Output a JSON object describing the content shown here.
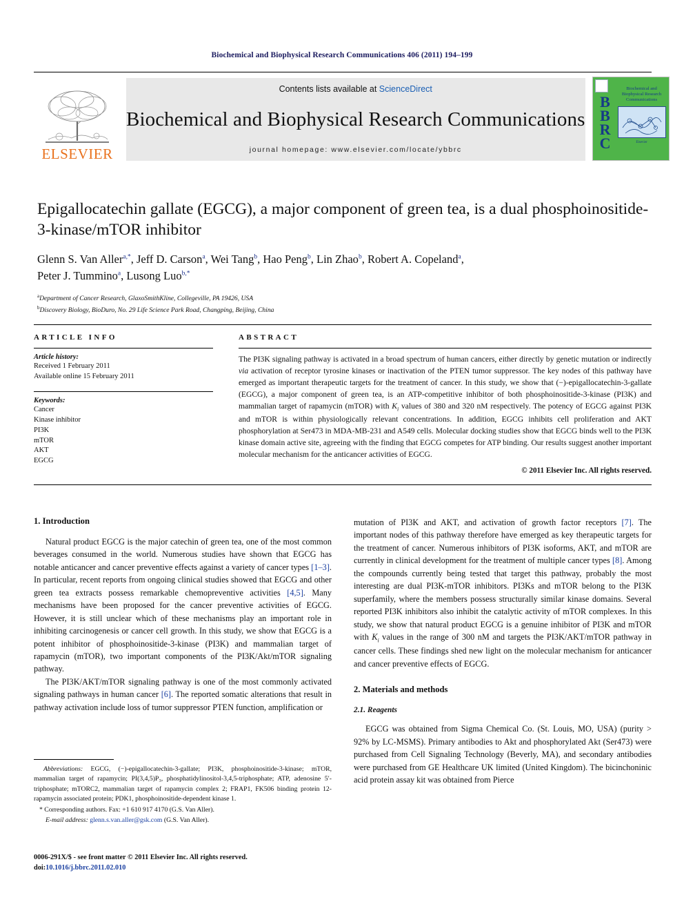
{
  "running_head": "Biochemical and Biophysical Research Communications 406 (2011) 194–199",
  "masthead": {
    "contents_prefix": "Contents lists available at ",
    "sciencedirect": "ScienceDirect",
    "journal_title": "Biochemical and Biophysical Research Communications",
    "homepage": "journal homepage: www.elsevier.com/locate/ybbrc",
    "elsevier_wordmark": "ELSEVIER",
    "cover_letters": [
      "B",
      "B",
      "R",
      "C"
    ],
    "cover_title": "Biochemical and Biophysical Research Communications",
    "cover_footmark": "Elsevier"
  },
  "article": {
    "title": "Epigallocatechin gallate (EGCG), a major component of green tea, is a dual phosphoinositide-3-kinase/mTOR inhibitor",
    "authors": [
      {
        "name": "Glenn S. Van Aller",
        "sup": "a,*"
      },
      {
        "name": "Jeff D. Carson",
        "sup": "a"
      },
      {
        "name": "Wei Tang",
        "sup": "b"
      },
      {
        "name": "Hao Peng",
        "sup": "b"
      },
      {
        "name": "Lin Zhao",
        "sup": "b"
      },
      {
        "name": "Robert A. Copeland",
        "sup": "a"
      },
      {
        "name": "Peter J. Tummino",
        "sup": "a"
      },
      {
        "name": "Lusong Luo",
        "sup": "b,*"
      }
    ],
    "affiliations": [
      {
        "mark": "a",
        "text": "Department of Cancer Research, GlaxoSmithKline, Collegeville, PA 19426, USA"
      },
      {
        "mark": "b",
        "text": "Discovery Biology, BioDuro, No. 29 Life Science Park Road, Changping, Beijing, China"
      }
    ]
  },
  "article_info": {
    "label": "ARTICLE INFO",
    "history_head": "Article history:",
    "history_lines": [
      "Received 1 February 2011",
      "Available online 15 February 2011"
    ],
    "keywords_head": "Keywords:",
    "keywords": [
      "Cancer",
      "Kinase inhibitor",
      "PI3K",
      "mTOR",
      "AKT",
      "EGCG"
    ]
  },
  "abstract": {
    "label": "ABSTRACT",
    "text_part1": "The PI3K signaling pathway is activated in a broad spectrum of human cancers, either directly by genetic mutation or indirectly ",
    "via": "via",
    "text_part2": " activation of receptor tyrosine kinases or inactivation of the PTEN tumor suppressor. The key nodes of this pathway have emerged as important therapeutic targets for the treatment of cancer. In this study, we show that (−)-epigallocatechin-3-gallate (EGCG), a major component of green tea, is an ATP-competitive inhibitor of both phosphoinositide-3-kinase (PI3K) and mammalian target of rapamycin (mTOR) with ",
    "ki_symbol": "K",
    "ki_sub": "i",
    "text_part3": " values of 380 and 320 nM respectively. The potency of EGCG against PI3K and mTOR is within physiologically relevant concentrations. In addition, EGCG inhibits cell proliferation and AKT phosphorylation at Ser473 in MDA-MB-231 and A549 cells. Molecular docking studies show that EGCG binds well to the PI3K kinase domain active site, agreeing with the finding that EGCG competes for ATP binding. Our results suggest another important molecular mechanism for the anticancer activities of EGCG.",
    "copyright": "© 2011 Elsevier Inc. All rights reserved."
  },
  "body": {
    "intro_heading": "1. Introduction",
    "intro_p1_a": "Natural product EGCG is the major catechin of green tea, one of the most common beverages consumed in the world. Numerous studies have shown that EGCG has notable anticancer and cancer preventive effects against a variety of cancer types ",
    "intro_p1_ref1": "[1–3]",
    "intro_p1_b": ". In particular, recent reports from ongoing clinical studies showed that EGCG and other green tea extracts possess remarkable chemopreventive activities ",
    "intro_p1_ref2": "[4,5]",
    "intro_p1_c": ". Many mechanisms have been proposed for the cancer preventive activities of EGCG. However, it is still unclear which of these mechanisms play an important role in inhibiting carcinogenesis or cancer cell growth. In this study, we show that EGCG is a potent inhibitor of phosphoinositide-3-kinase (PI3K) and mammalian target of rapamycin (mTOR), two important components of the PI3K/Akt/mTOR signaling pathway.",
    "intro_p2_a": "The PI3K/AKT/mTOR signaling pathway is one of the most commonly activated signaling pathways in human cancer ",
    "intro_p2_ref": "[6]",
    "intro_p2_b": ". The reported somatic alterations that result in pathway activation include loss of tumor suppressor PTEN function, amplification or",
    "right_p1_a": "mutation of PI3K and AKT, and activation of growth factor receptors ",
    "right_p1_ref1": "[7]",
    "right_p1_b": ". The important nodes of this pathway therefore have emerged as key therapeutic targets for the treatment of cancer. Numerous inhibitors of PI3K isoforms, AKT, and mTOR are currently in clinical development for the treatment of multiple cancer types ",
    "right_p1_ref2": "[8]",
    "right_p1_c": ". Among the compounds currently being tested that target this pathway, probably the most interesting are dual PI3K-mTOR inhibitors. PI3Ks and mTOR belong to the PI3K superfamily, where the members possess structurally similar kinase domains. Several reported PI3K inhibitors also inhibit the catalytic activity of mTOR complexes. In this study, we show that natural product EGCG is a genuine inhibitor of PI3K and mTOR with ",
    "right_p1_ki": "K",
    "right_p1_ki_sub": "i",
    "right_p1_d": " values in the range of 300 nM and targets the PI3K/AKT/mTOR pathway in cancer cells. These findings shed new light on the molecular mechanism for anticancer and cancer preventive effects of EGCG.",
    "materials_heading": "2. Materials and methods",
    "reagents_heading": "2.1. Reagents",
    "reagents_p1": "EGCG was obtained from Sigma Chemical Co. (St. Louis, MO, USA) (purity > 92% by LC-MSMS). Primary antibodies to Akt and phosphorylated Akt (Ser473) were purchased from Cell Signaling Technology (Beverly, MA), and secondary antibodies were purchased from GE Healthcare UK limited (United Kingdom). The bicinchoninic acid protein assay kit was obtained from Pierce"
  },
  "footnotes": {
    "abbrev_label": "Abbreviations:",
    "abbrev_text": " EGCG, (−)-epigallocatechin-3-gallate; PI3K, phosphoinositide-3-kinase; mTOR, mammalian target of rapamycin; PI(3,4,5)P₃, phosphatidylinositol-3,4,5-triphosphate; ATP, adenosine 5′-triphosphate; mTORC2, mammalian target of rapamycin complex 2; FRAP1, FK506 binding protein 12-rapamycin associated protein; PDK1, phosphoinositide-dependent kinase 1.",
    "corresponding": "* Corresponding authors. Fax: +1 610 917 4170 (G.S. Van Aller).",
    "email_label": "E-mail address:",
    "email": "glenn.s.van.aller@gsk.com",
    "email_suffix": " (G.S. Van Aller)."
  },
  "footer": {
    "issn_line": "0006-291X/$ - see front matter © 2011 Elsevier Inc. All rights reserved.",
    "doi_label": "doi:",
    "doi_value": "10.1016/j.bbrc.2011.02.010"
  },
  "colors": {
    "link_blue": "#1a3fa0",
    "header_navy": "#1a1a5e",
    "elsevier_orange": "#E9711C",
    "bbrc_green": "#4fb449"
  }
}
